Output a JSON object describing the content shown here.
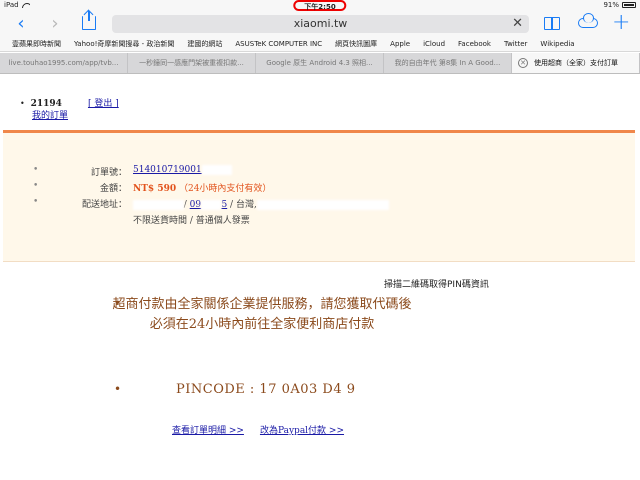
{
  "status_bar": {
    "device": "iPad",
    "time": "下午2:50",
    "battery": "91%"
  },
  "toolbar": {
    "url": "xiaomi.tw",
    "back_icon": "chevron-left-icon",
    "forward_icon": "chevron-right-icon",
    "share_icon": "share-icon",
    "clear_icon": "close-icon",
    "bookmarks_icon": "book-icon",
    "cloud_icon": "cloud-icon",
    "new_tab_icon": "plus-icon",
    "accent_color": "#1a7cf5"
  },
  "bookmarks": [
    "壹蘋果即時新聞",
    "Yahoo!奇摩新聞搜尋 - 政治新聞",
    "建國的網站",
    "ASUSTeK COMPUTER INC",
    "網頁快訊圖庫",
    "Apple",
    "iCloud",
    "Facebook",
    "Twitter",
    "Wikipedia"
  ],
  "tabs": [
    {
      "label": "live.touhao1995.com/app/tvb..."
    },
    {
      "label": "一秒鐘同一感應門架被重複扣款..."
    },
    {
      "label": "Google 原生 Android 4.3 照相..."
    },
    {
      "label": "我的自由年代 第8集 In A Good..."
    },
    {
      "label": "使用超商（全家）支付訂單"
    }
  ],
  "page": {
    "user_id": "21194",
    "logout_link": "[ 登出 ]",
    "my_orders_link": "我的訂單",
    "order": {
      "order_no_label": "訂單號：",
      "order_no": "514010719001",
      "amount_label": "金額：",
      "amount": "NT$ 590",
      "amount_note": "（24小時內支付有效）",
      "address_label": "配送地址：",
      "address_phone": "09",
      "address_region": "/ 台灣,",
      "delivery_note": "不限送貨時間 / 普通個人發票"
    },
    "scan_title": "掃描二維碼取得PIN碼資訊",
    "notice": "超商付款由全家關係企業提供服務，請您獲取代碼後必須在24小時內前往全家便利商店付款",
    "pincode": "PINCODE : 17   0A03   D4   9",
    "view_order_link": "查看訂單明細 >>",
    "paypal_link": "改為Paypal付款 >>"
  }
}
